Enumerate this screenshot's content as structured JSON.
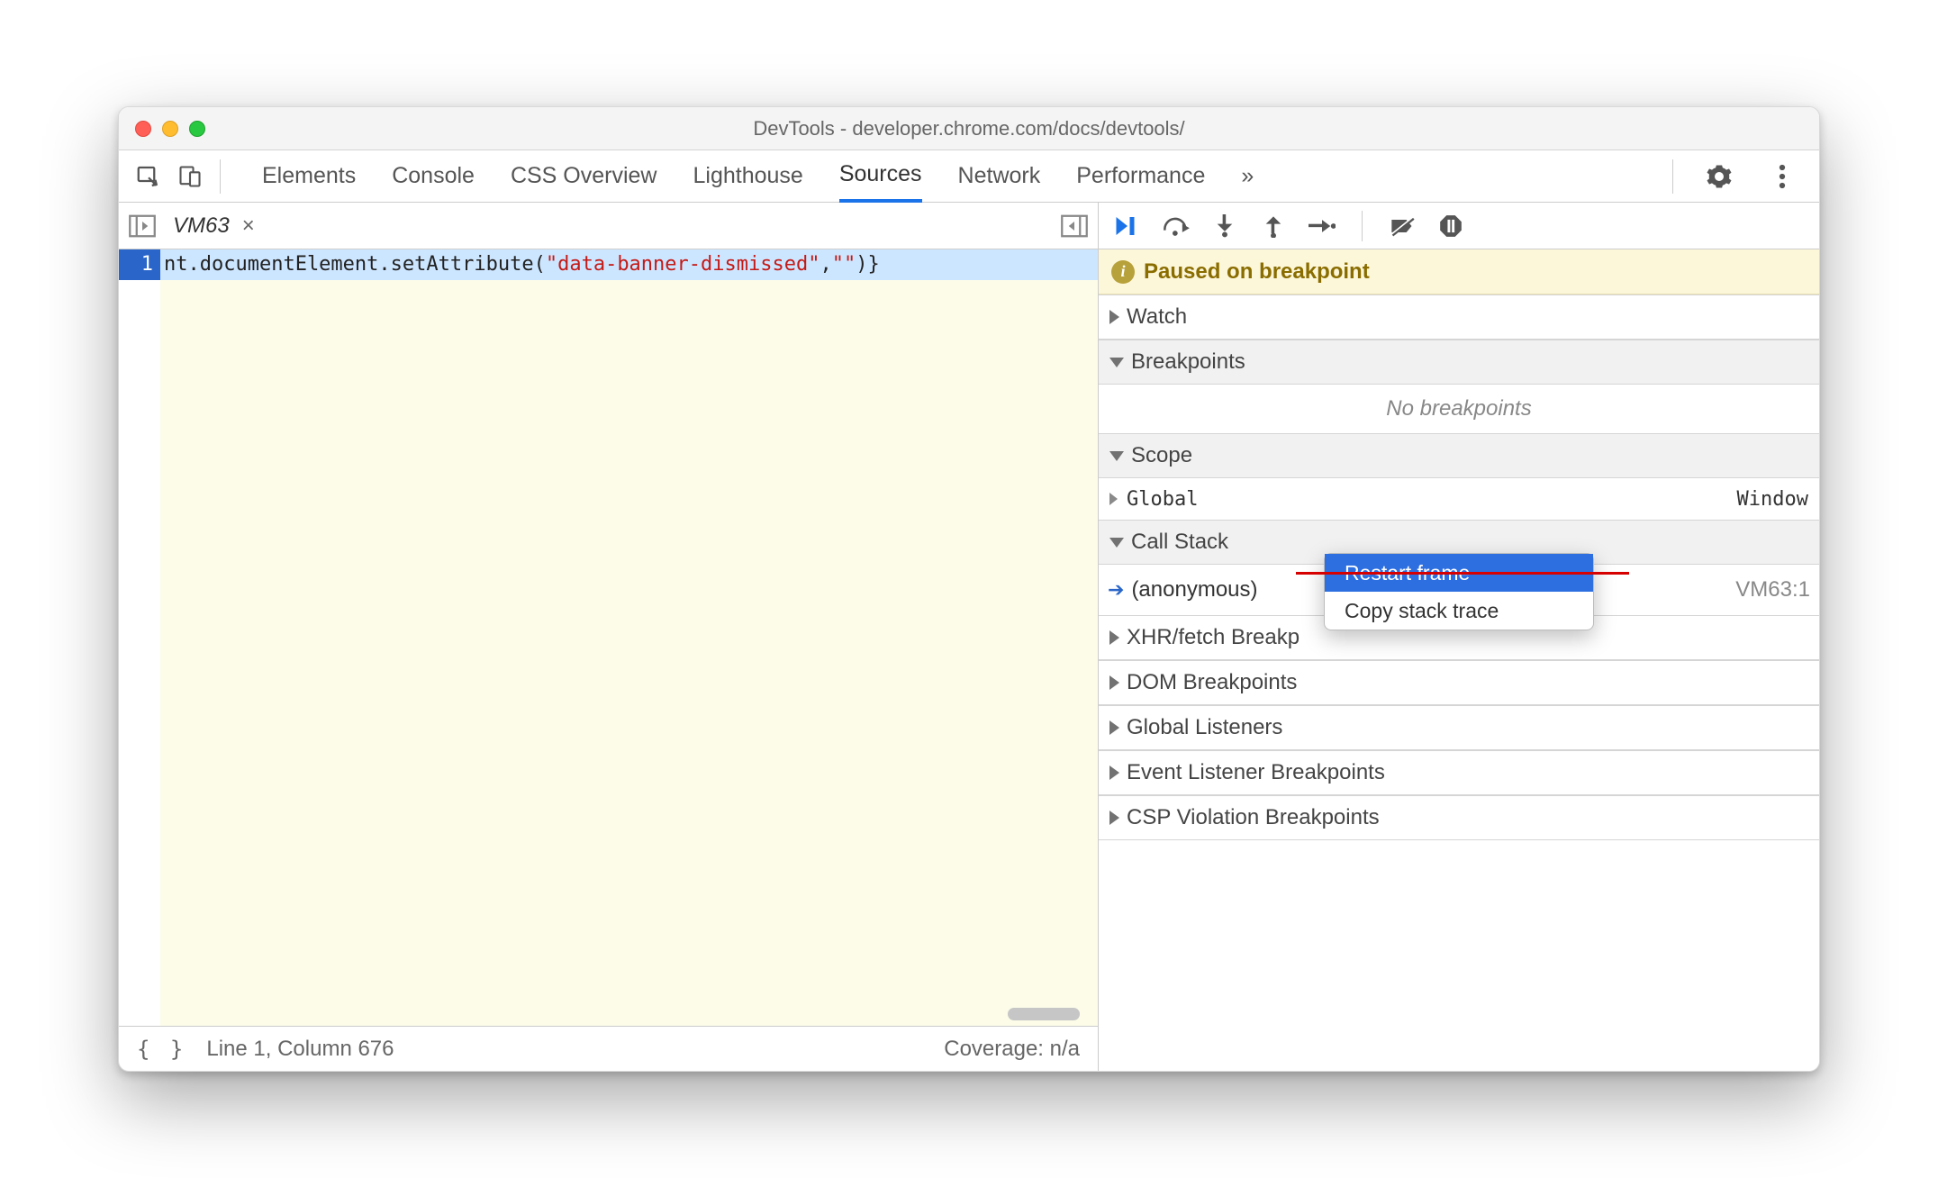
{
  "window": {
    "title": "DevTools - developer.chrome.com/docs/devtools/"
  },
  "mainTabs": {
    "items": [
      "Elements",
      "Console",
      "CSS Overview",
      "Lighthouse",
      "Sources",
      "Network",
      "Performance"
    ],
    "overflow": "»",
    "activeIndex": 4
  },
  "editor": {
    "openFile": "VM63",
    "lineNumber": "1",
    "codePrefix": "nt.documentElement.setAttribute(",
    "codeString": "\"data-banner-dismissed\"",
    "codeMid": ",",
    "codeString2": "\"\"",
    "codeSuffix": ")}",
    "status": {
      "brackets": "{ }",
      "cursor": "Line 1, Column 676",
      "coverage": "Coverage: n/a"
    }
  },
  "debugger": {
    "pausedMessage": "Paused on breakpoint",
    "sections": {
      "watch": "Watch",
      "breakpoints": "Breakpoints",
      "breakpointsEmpty": "No breakpoints",
      "scope": "Scope",
      "scopeGlobalLabel": "Global",
      "scopeGlobalValue": "Window",
      "callStack": "Call Stack",
      "callStackFrame": "(anonymous)",
      "callStackLoc": "VM63:1",
      "xhr": "XHR/fetch Breakp",
      "dom": "DOM Breakpoints",
      "globalListeners": "Global Listeners",
      "eventListener": "Event Listener Breakpoints",
      "csp": "CSP Violation Breakpoints"
    },
    "contextMenu": {
      "restart": "Restart frame",
      "copy": "Copy stack trace"
    }
  }
}
